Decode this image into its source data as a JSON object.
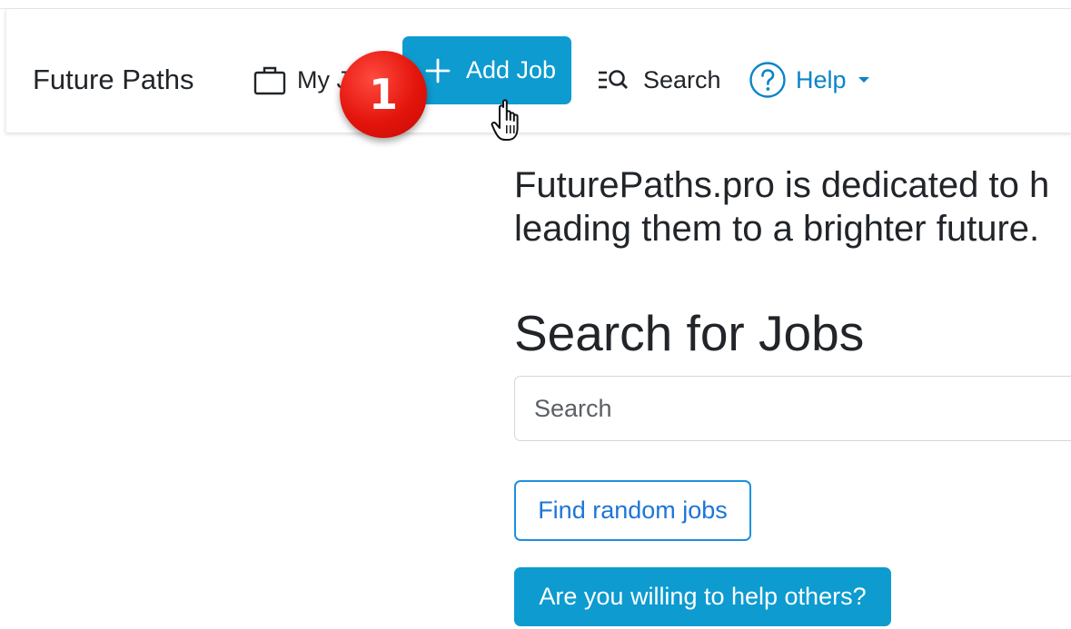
{
  "navbar": {
    "brand": "Future Paths",
    "my_jobs_label": "My Jobs",
    "add_job_label": "Add Job",
    "search_label": "Search",
    "help_label": "Help"
  },
  "annotation": {
    "step_number": "1"
  },
  "main": {
    "intro_line1": "FuturePaths.pro is dedicated to h",
    "intro_line2": "leading them to a brighter future.",
    "heading": "Search for Jobs",
    "search_placeholder": "Search",
    "random_button_label": "Find random jobs",
    "help_others_button_label": "Are you willing to help others?"
  },
  "colors": {
    "primary": "#0d9bd0",
    "link": "#0a84c8",
    "outline_border": "#1d8fdd",
    "badge_red": "#e3140b"
  },
  "icons": [
    "briefcase-icon",
    "plus-icon",
    "search-list-icon",
    "help-circle-icon",
    "caret-down-icon",
    "hand-pointer-cursor"
  ]
}
